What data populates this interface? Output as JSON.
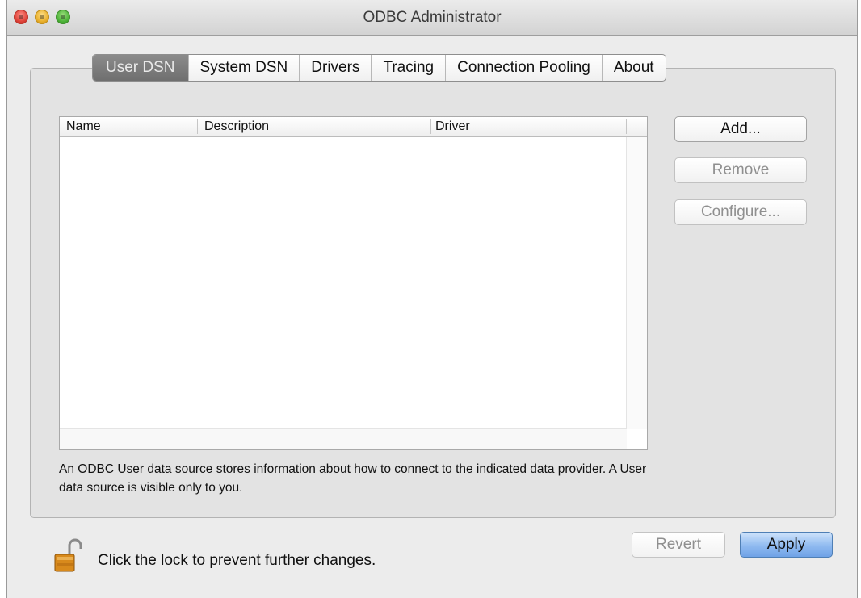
{
  "window": {
    "title": "ODBC Administrator"
  },
  "tabs": [
    {
      "label": "User DSN",
      "selected": true
    },
    {
      "label": "System DSN",
      "selected": false
    },
    {
      "label": "Drivers",
      "selected": false
    },
    {
      "label": "Tracing",
      "selected": false
    },
    {
      "label": "Connection Pooling",
      "selected": false
    },
    {
      "label": "About",
      "selected": false
    }
  ],
  "table": {
    "columns": [
      "Name",
      "Description",
      "Driver"
    ],
    "rows": []
  },
  "actions": {
    "add_label": "Add...",
    "remove_label": "Remove",
    "configure_label": "Configure..."
  },
  "description": "An ODBC User data source stores information about how to connect to the indicated data provider. A User data source is visible only to you.",
  "footer": {
    "lock_text": "Click the lock to prevent further changes.",
    "revert_label": "Revert",
    "apply_label": "Apply"
  },
  "colors": {
    "accent": "#8fbaf0",
    "selected_tab": "#7a7a7a",
    "window_bg": "#ececec"
  },
  "icons": [
    "close-icon",
    "minimize-icon",
    "zoom-icon",
    "lock-icon"
  ]
}
